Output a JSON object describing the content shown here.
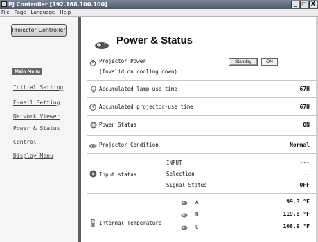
{
  "window": {
    "title": "PJ Controller [192.168.100.100]",
    "buttons": [
      "_",
      "□",
      "X"
    ]
  },
  "menubar": [
    "File",
    "Page",
    "Language",
    "Help"
  ],
  "sidebar": {
    "logo": "Projector Controller",
    "main_menu_label": "Main Menu",
    "items": [
      "Initial Setting",
      "E-mail Setting",
      "Network Viewer",
      "Power & Status",
      "Control",
      "Display Menu"
    ]
  },
  "main": {
    "title": "Power & Status",
    "projector_power": {
      "label": "Projector Power",
      "note": "(Invalid on cooling down)",
      "standby_label": "Standby",
      "on_label": "ON"
    },
    "lamp_time": {
      "label": "Accumulated lamp-use time",
      "value": "67H"
    },
    "projector_time": {
      "label": "Accumulated projector-use time",
      "value": "67H"
    },
    "power_status": {
      "label": "Power Status",
      "value": "ON"
    },
    "projector_condition": {
      "label": "Projector Condition",
      "value": "Normal"
    },
    "input_status": {
      "label": "Input status",
      "rows": [
        {
          "name": "INPUT",
          "value": "---"
        },
        {
          "name": "Selection",
          "value": "---"
        },
        {
          "name": "Signal Status",
          "value": "OFF"
        }
      ]
    },
    "internal_temperature": {
      "label": "Internal Temperature",
      "sensors": [
        {
          "name": "A",
          "value": "99.3 °F"
        },
        {
          "name": "B",
          "value": "119.8 °F"
        },
        {
          "name": "C",
          "value": "108.9 °F"
        }
      ]
    }
  },
  "icons": {
    "app": "projector-app-icon",
    "heading": "projector-icon",
    "power": "power-icon",
    "lamp": "lamp-icon",
    "clock": "clock-icon",
    "power_status": "power-status-icon",
    "condition": "projector-condition-icon",
    "input": "input-icon",
    "thermometer": "thermometer-icon",
    "sensor": "sensor-icon"
  }
}
